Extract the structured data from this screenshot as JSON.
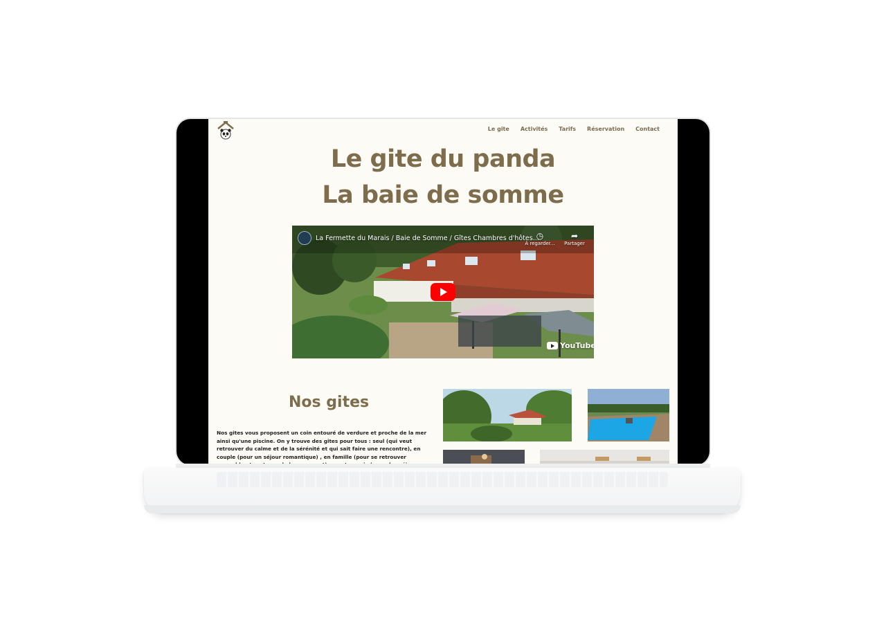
{
  "site": {
    "nav": {
      "items": [
        {
          "label": "Le gite"
        },
        {
          "label": "Activités"
        },
        {
          "label": "Tarifs"
        },
        {
          "label": "Réservation"
        },
        {
          "label": "Contact"
        }
      ],
      "logo_icon": "panda-house-logo-icon"
    },
    "hero": {
      "title_line1": "Le gite du panda",
      "title_line2": "La baie de somme"
    },
    "video": {
      "title": "La Fermette du Marais / Baie de Somme / Gîtes Chambres d'hôtes...",
      "watch_later_label": "À regarder...",
      "share_label": "Partager",
      "brand": "YouTube"
    },
    "section": {
      "title": "Nos gites",
      "text": "Nos gites vous proposent un coin entouré de verdure et proche de la mer ainsi qu'une piscine. On y trouve des gites pour tous : seul (qui veut retrouver du calme et de la sérénité et qui sait faire une rencontre), en couple (pour un séjour romantique) , en famille (pour se retrouver ensemble et partager de bon moment) ou entre amis (pour des séjour sportifs et détente)."
    }
  },
  "colors": {
    "accent": "#7e6d4c",
    "page_background": "#fcfbf6",
    "youtube_red": "#ff0000"
  }
}
